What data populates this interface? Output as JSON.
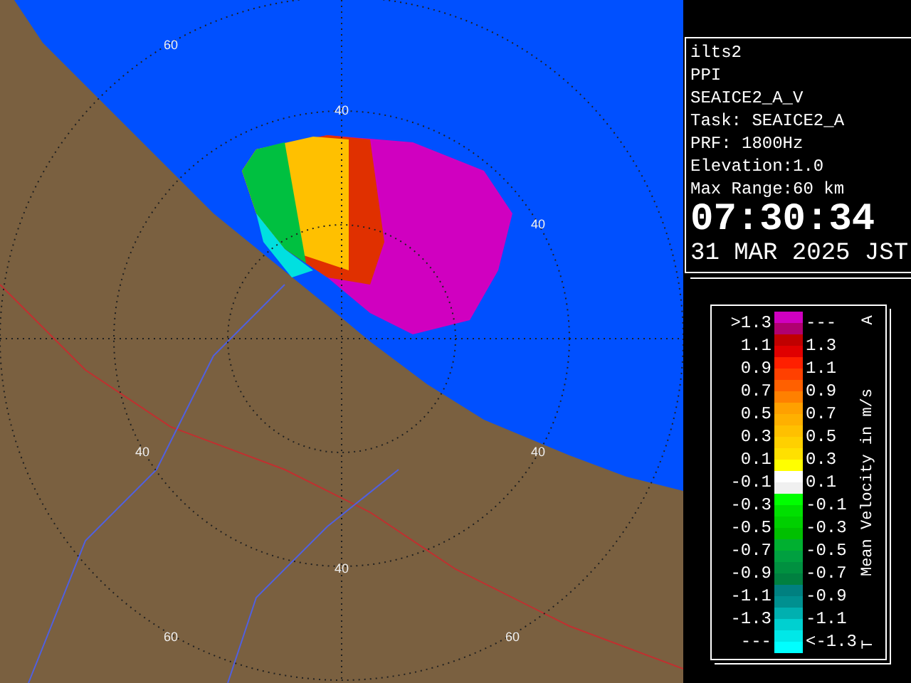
{
  "map": {
    "ring_labels": [
      "60",
      "40",
      "40",
      "40",
      "40",
      "40",
      "60",
      "60"
    ]
  },
  "info": {
    "lines": [
      "ilts2",
      "PPI",
      "SEAICE2_A_V",
      "Task: SEAICE2_A",
      "PRF: 1800Hz",
      "Elevation:1.0",
      "Max Range:60 km"
    ],
    "time": "07:30:34",
    "date": "31 MAR 2025 JST"
  },
  "legend": {
    "top_mark": "A",
    "bottom_mark": "T",
    "axis_title": "Mean Velocity in m/s",
    "rows": [
      {
        "upper": ">1.3",
        "lower": "---",
        "bands": [
          {
            "color": "#d000c0"
          },
          {
            "color": "#b00070"
          }
        ]
      },
      {
        "upper": "1.1",
        "lower": "1.3",
        "bands": [
          {
            "color": "#c00000"
          },
          {
            "color": "#e00000"
          }
        ]
      },
      {
        "upper": "0.9",
        "lower": "1.1",
        "bands": [
          {
            "color": "#ff2000"
          },
          {
            "color": "#ff4000"
          }
        ]
      },
      {
        "upper": "0.7",
        "lower": "0.9",
        "bands": [
          {
            "color": "#ff6000"
          },
          {
            "color": "#ff8000"
          }
        ]
      },
      {
        "upper": "0.5",
        "lower": "0.7",
        "bands": [
          {
            "color": "#ffa000"
          },
          {
            "color": "#ffb000"
          }
        ]
      },
      {
        "upper": "0.3",
        "lower": "0.5",
        "bands": [
          {
            "color": "#ffc000"
          },
          {
            "color": "#ffd000"
          }
        ]
      },
      {
        "upper": "0.1",
        "lower": "0.3",
        "bands": [
          {
            "color": "#ffe000"
          },
          {
            "color": "#ffff00"
          }
        ]
      },
      {
        "upper": "-0.1",
        "lower": "0.1",
        "bands": [
          {
            "color": "#ffffff"
          },
          {
            "color": "#f0f0f0"
          }
        ]
      },
      {
        "upper": "-0.3",
        "lower": "-0.1",
        "bands": [
          {
            "color": "#00ff00"
          },
          {
            "color": "#00e000"
          }
        ]
      },
      {
        "upper": "-0.5",
        "lower": "-0.3",
        "bands": [
          {
            "color": "#00d000"
          },
          {
            "color": "#00c000"
          }
        ]
      },
      {
        "upper": "-0.7",
        "lower": "-0.5",
        "bands": [
          {
            "color": "#00b030"
          },
          {
            "color": "#00a040"
          }
        ]
      },
      {
        "upper": "-0.9",
        "lower": "-0.7",
        "bands": [
          {
            "color": "#009040"
          },
          {
            "color": "#008040"
          }
        ]
      },
      {
        "upper": "-1.1",
        "lower": "-0.9",
        "bands": [
          {
            "color": "#008080"
          },
          {
            "color": "#009090"
          }
        ]
      },
      {
        "upper": "-1.3",
        "lower": "-1.1",
        "bands": [
          {
            "color": "#00b0b0"
          },
          {
            "color": "#00d0d0"
          }
        ]
      },
      {
        "upper": "---",
        "lower": "<-1.3",
        "bands": [
          {
            "color": "#00e8e8"
          },
          {
            "color": "#00ffff"
          }
        ]
      }
    ]
  }
}
